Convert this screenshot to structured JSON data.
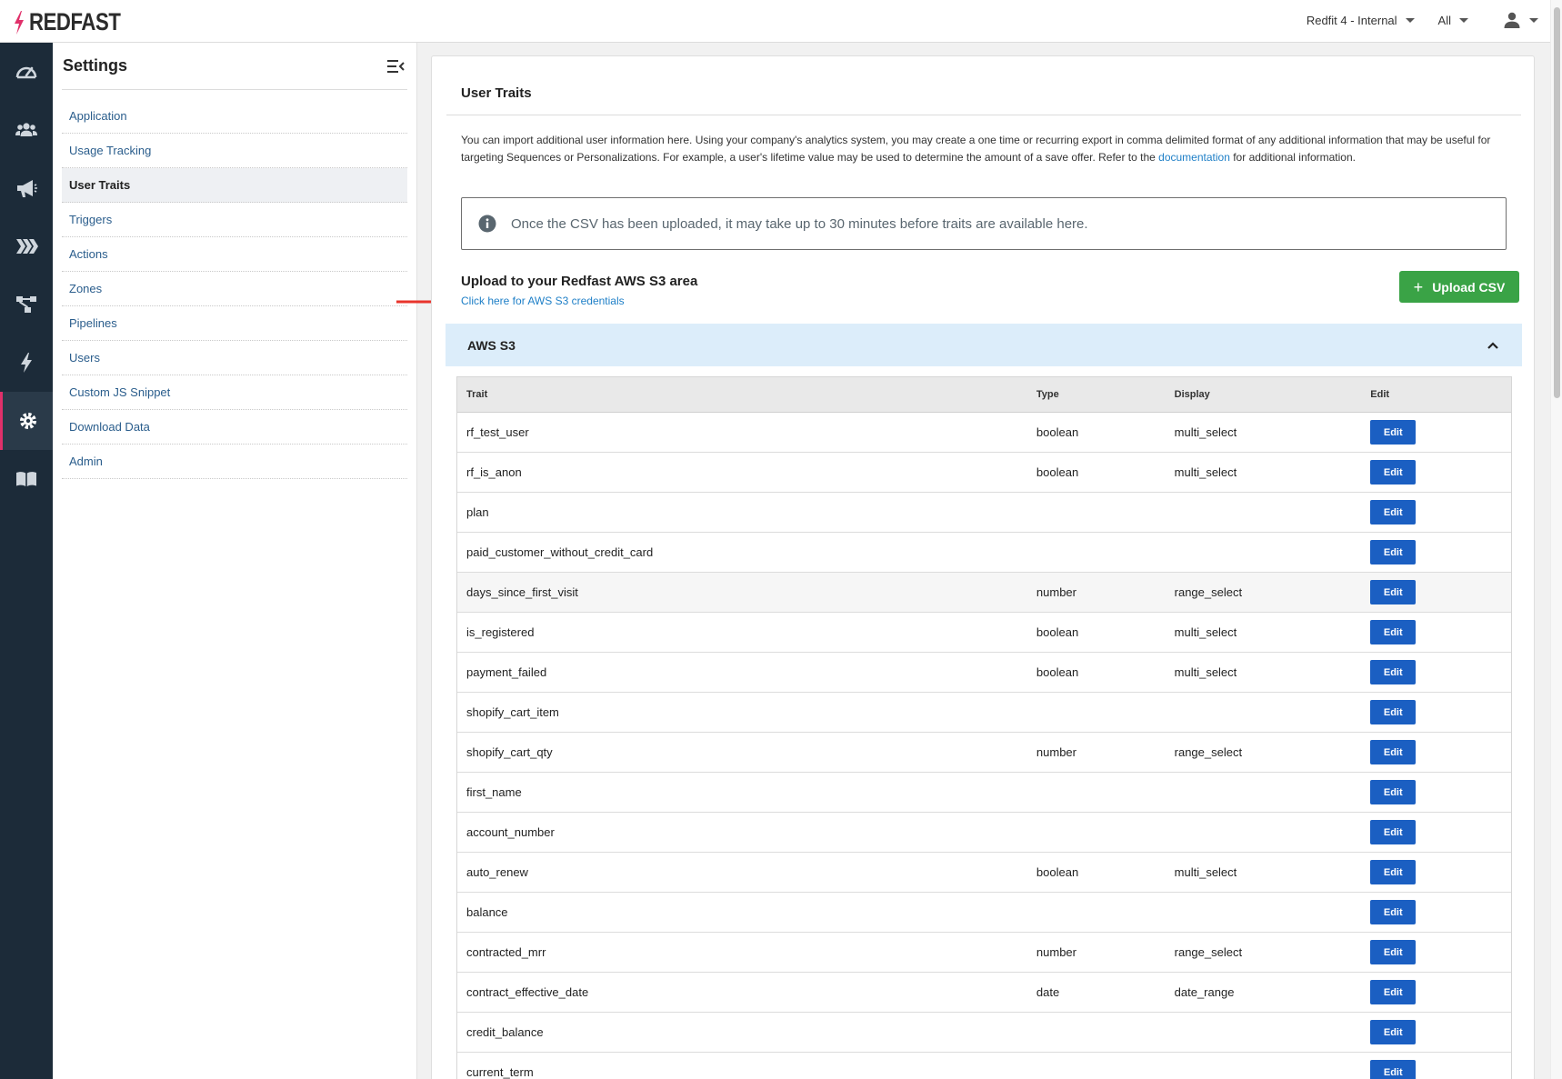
{
  "brand": {
    "name": "REDFAST",
    "accent": "#e0306a"
  },
  "topbar": {
    "workspace": "Redfit 4 - Internal",
    "filter": "All"
  },
  "rail": [
    "speedometer-icon",
    "users-icon",
    "megaphone-icon",
    "chevrons-icon",
    "flow-icon",
    "bolt-icon",
    "gear-icon",
    "book-icon"
  ],
  "settings": {
    "title": "Settings",
    "items": [
      {
        "label": "Application"
      },
      {
        "label": "Usage Tracking"
      },
      {
        "label": "User Traits"
      },
      {
        "label": "Triggers"
      },
      {
        "label": "Actions"
      },
      {
        "label": "Zones"
      },
      {
        "label": "Pipelines"
      },
      {
        "label": "Users"
      },
      {
        "label": "Custom JS Snippet"
      },
      {
        "label": "Download Data"
      },
      {
        "label": "Admin"
      }
    ],
    "active": "User Traits"
  },
  "main": {
    "title": "User Traits",
    "desc_1": "You can import additional user information here. Using your company's analytics system, you may create a one time or recurring export in comma delimited format of any additional information that may be useful for targeting Sequences or Personalizations. For example, a user's lifetime value may be used to determine the amount of a save offer. Refer to the ",
    "desc_link": "documentation",
    "desc_2": " for additional information.",
    "notice": "Once the CSV has been uploaded, it may take up to 30 minutes before traits are available here.",
    "upload_title": "Upload to your Redfast AWS S3 area",
    "upload_link": "Click here for AWS S3 credentials",
    "upload_button": "Upload CSV",
    "accordion_title": "AWS S3"
  },
  "table": {
    "headers": {
      "trait": "Trait",
      "type": "Type",
      "display": "Display",
      "edit": "Edit"
    },
    "edit_label": "Edit",
    "rows": [
      {
        "trait": "rf_test_user",
        "type": "boolean",
        "display": "multi_select"
      },
      {
        "trait": "rf_is_anon",
        "type": "boolean",
        "display": "multi_select"
      },
      {
        "trait": "plan",
        "type": "",
        "display": ""
      },
      {
        "trait": "paid_customer_without_credit_card",
        "type": "",
        "display": ""
      },
      {
        "trait": "days_since_first_visit",
        "type": "number",
        "display": "range_select"
      },
      {
        "trait": "is_registered",
        "type": "boolean",
        "display": "multi_select"
      },
      {
        "trait": "payment_failed",
        "type": "boolean",
        "display": "multi_select"
      },
      {
        "trait": "shopify_cart_item",
        "type": "",
        "display": ""
      },
      {
        "trait": "shopify_cart_qty",
        "type": "number",
        "display": "range_select"
      },
      {
        "trait": "first_name",
        "type": "",
        "display": ""
      },
      {
        "trait": "account_number",
        "type": "",
        "display": ""
      },
      {
        "trait": "auto_renew",
        "type": "boolean",
        "display": "multi_select"
      },
      {
        "trait": "balance",
        "type": "",
        "display": ""
      },
      {
        "trait": "contracted_mrr",
        "type": "number",
        "display": "range_select"
      },
      {
        "trait": "contract_effective_date",
        "type": "date",
        "display": "date_range"
      },
      {
        "trait": "credit_balance",
        "type": "",
        "display": ""
      },
      {
        "trait": "current_term",
        "type": "",
        "display": ""
      }
    ]
  }
}
